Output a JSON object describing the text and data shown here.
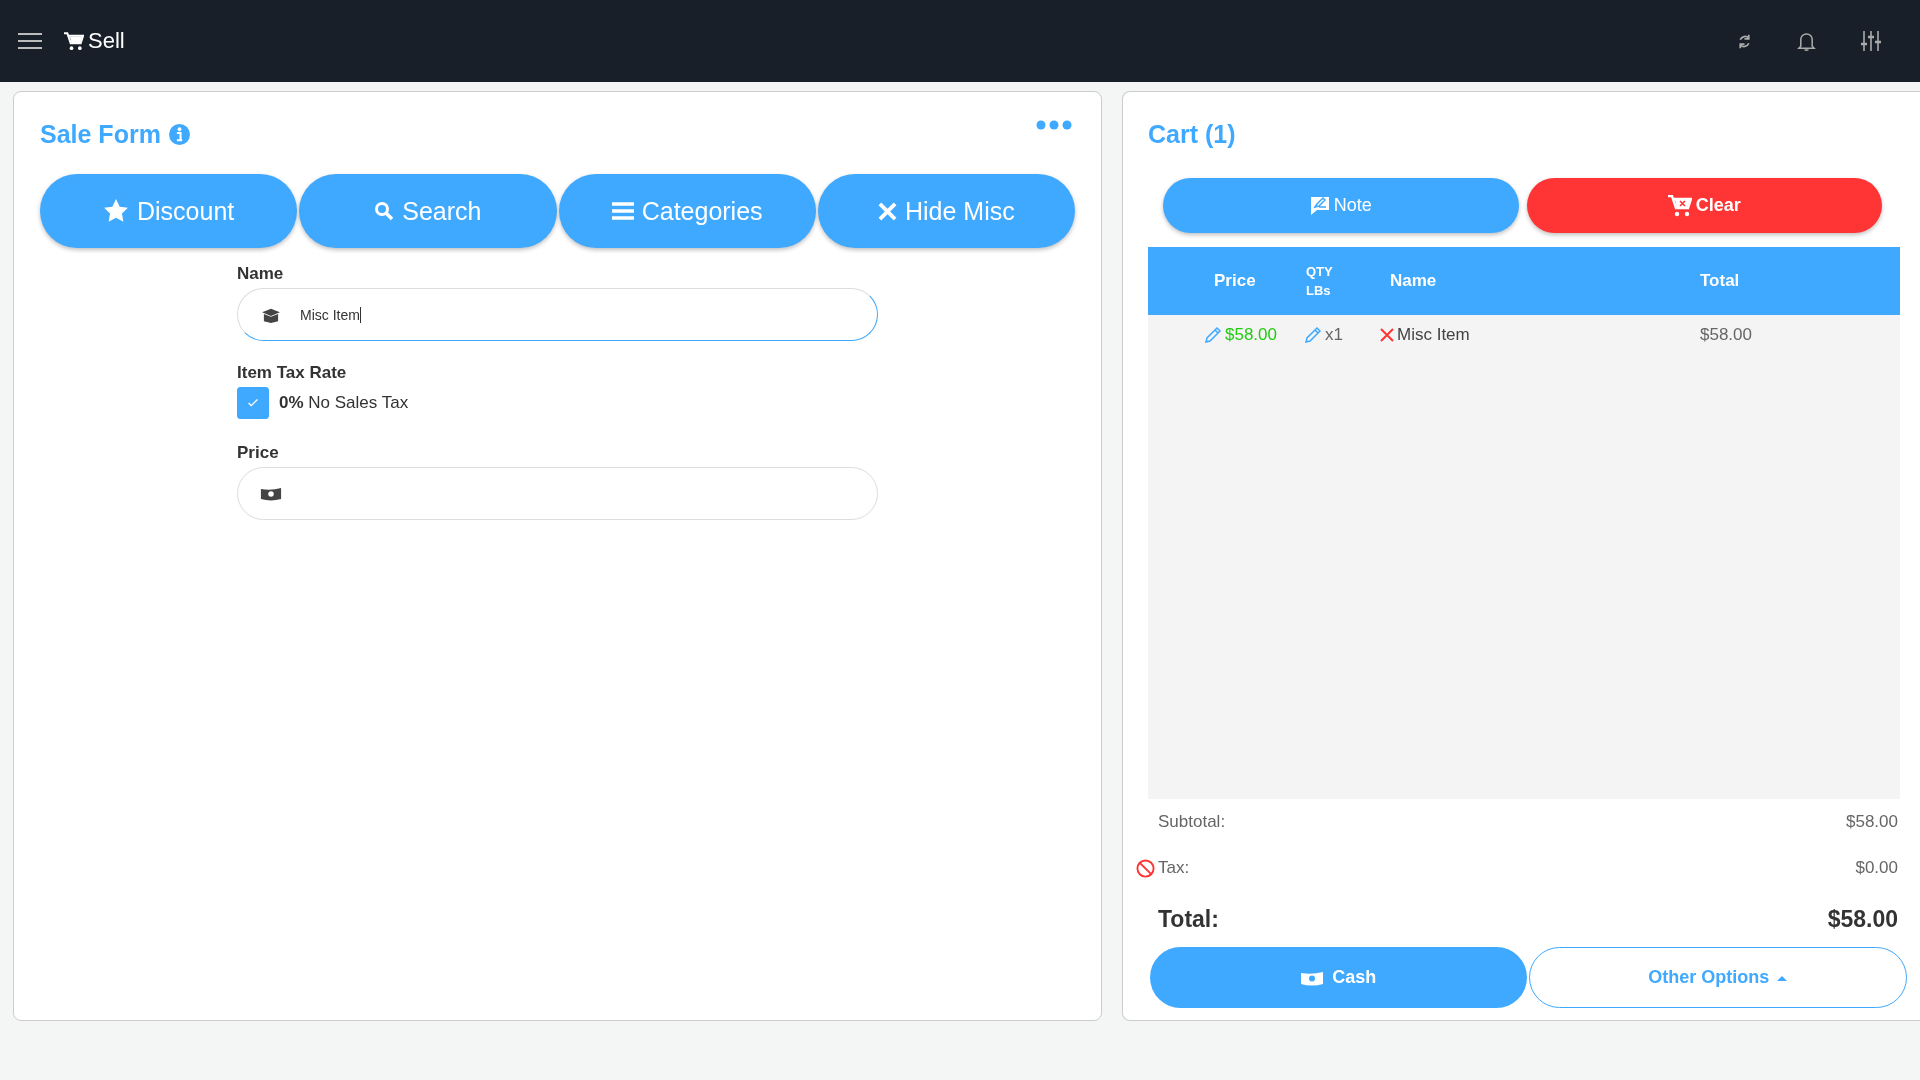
{
  "top_bar": {
    "title": "Sell"
  },
  "sale_form": {
    "title": "Sale Form",
    "buttons": [
      {
        "kind": "star",
        "label": "Discount"
      },
      {
        "kind": "search",
        "label": "Search"
      },
      {
        "kind": "list",
        "label": "Categories"
      },
      {
        "kind": "close",
        "label": "Hide Misc"
      }
    ],
    "name_label": "Name",
    "name_value": "Misc Item",
    "tax_label": "Item Tax Rate",
    "tax_option": {
      "text": "**0%** No Sales Tax",
      "checked": true
    },
    "price_label": "Price"
  },
  "cart": {
    "title": "Cart (1)",
    "note_button": "Note",
    "clear_button": "Clear",
    "columns": [
      "Price",
      "QTY\nLBs",
      "Name",
      "Total"
    ],
    "rows": [
      {
        "price": "$58.00",
        "qty": "x1",
        "name": "Misc Item",
        "total": "$58.00"
      }
    ],
    "subtotal_label": "Subtotal:",
    "subtotal": "$58.00",
    "tax_label": "Tax:",
    "tax": "$0.00",
    "total_label": "Total:",
    "total": "$58.00",
    "cash_button": "Cash",
    "other_button": "Other Options"
  }
}
